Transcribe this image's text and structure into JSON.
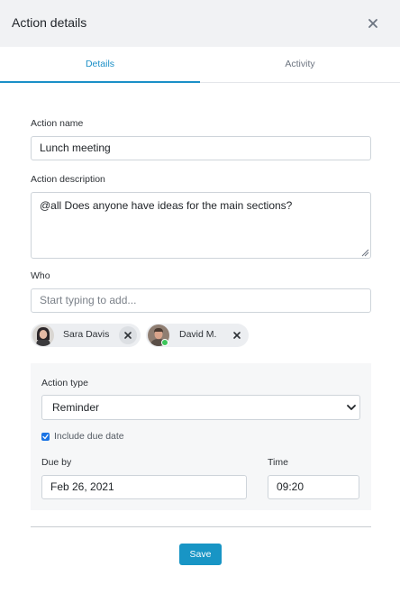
{
  "header": {
    "title": "Action details",
    "close_icon": "close-icon"
  },
  "tabs": [
    {
      "label": "Details",
      "active": true
    },
    {
      "label": "Activity",
      "active": false
    }
  ],
  "form": {
    "action_name": {
      "label": "Action name",
      "value": "Lunch meeting"
    },
    "action_description": {
      "label": "Action description",
      "value": "@all Does anyone have ideas for the main sections?"
    },
    "who": {
      "label": "Who",
      "placeholder": "Start typing to add...",
      "people": [
        {
          "name": "Sara Davis",
          "avatar_icon": "avatar-photo"
        },
        {
          "name": "David M.",
          "avatar_icon": "avatar-photo",
          "online": true
        }
      ]
    },
    "action_type": {
      "label": "Action type",
      "selected": "Reminder"
    },
    "include_due_date": {
      "label": "Include due date",
      "checked": true
    },
    "due_by": {
      "label": "Due by",
      "value": "Feb 26, 2021"
    },
    "time": {
      "label": "Time",
      "value": "09:20"
    }
  },
  "footer": {
    "save_label": "Save"
  },
  "colors": {
    "accent": "#1b8fc7",
    "save_button": "#1895c5",
    "checkbox": "#1b74e4",
    "online_status": "#3cc55a",
    "header_bg": "#f1f2f4",
    "panel_bg": "#f6f7f8"
  }
}
